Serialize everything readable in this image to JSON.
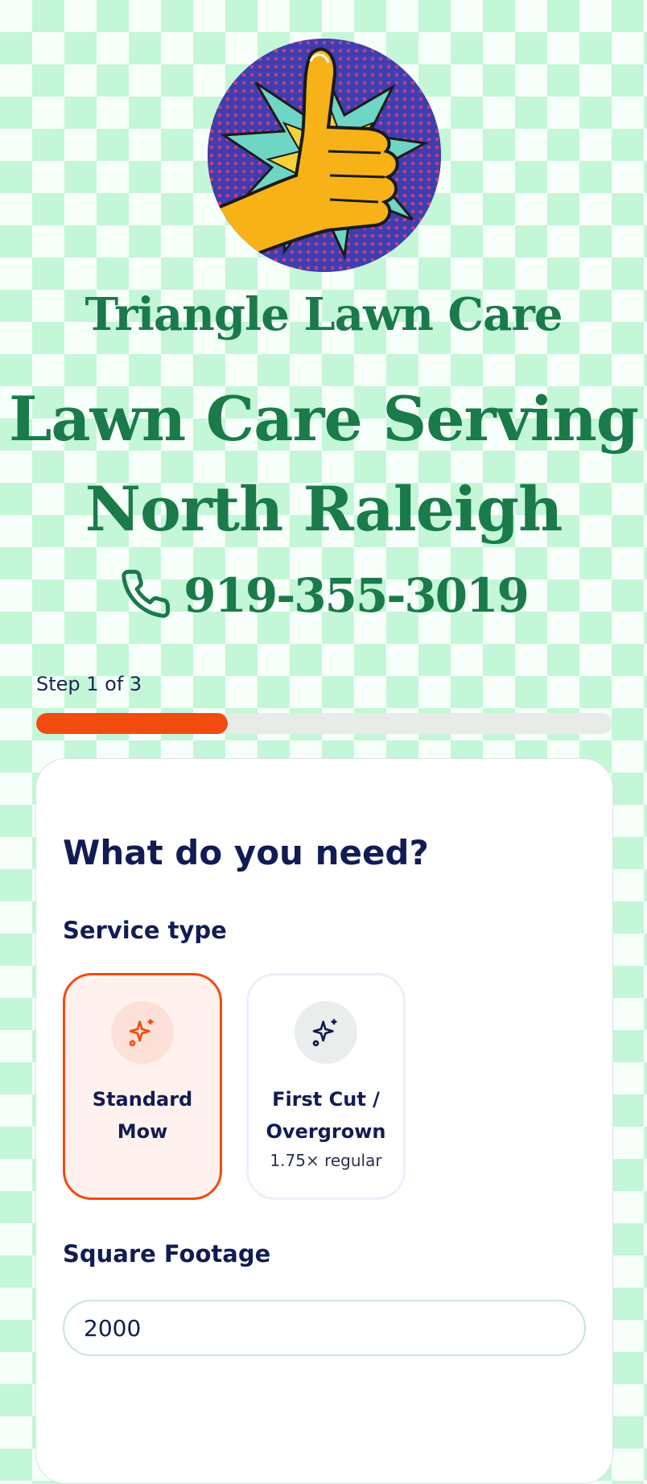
{
  "brand": {
    "name": "Triangle Lawn Care"
  },
  "headline": {
    "line1": "Lawn Care Serving",
    "line2": "North Raleigh"
  },
  "phone": {
    "number": "919-355-3019"
  },
  "progress": {
    "label": "Step 1 of 3",
    "fraction": 0.333
  },
  "form": {
    "title": "What do you need?",
    "service_type_label": "Service type",
    "options": [
      {
        "label": "Standard Mow",
        "sub": "",
        "selected": true
      },
      {
        "label": "First Cut / Overgrown",
        "sub": "1.75× regular",
        "selected": false
      }
    ],
    "sqft_label": "Square Footage",
    "sqft_value": "2000"
  },
  "colors": {
    "accent": "#f24b0f",
    "brand_green": "#1a7a4a",
    "navy": "#111c55"
  },
  "icons": {
    "option_icon": "sparkles-icon",
    "phone_icon": "phone-icon"
  }
}
